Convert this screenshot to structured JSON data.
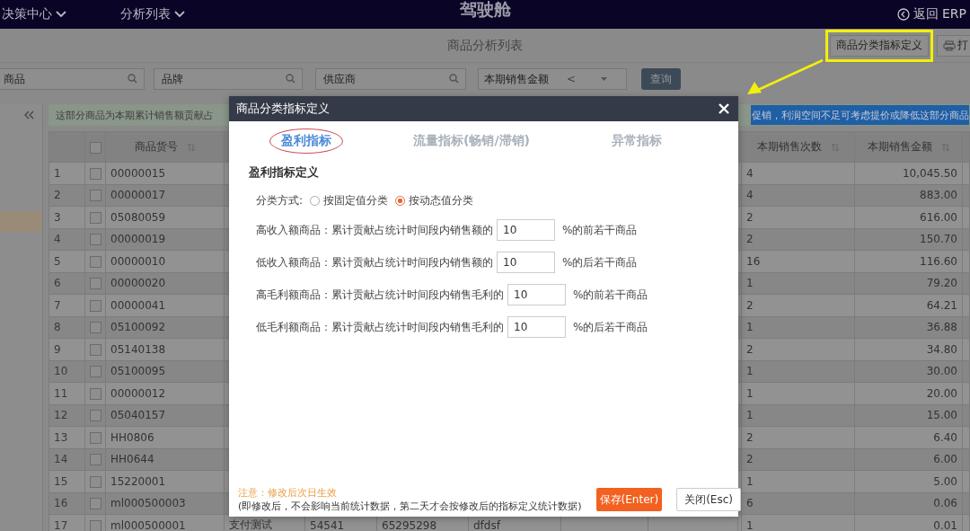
{
  "top_bar": {
    "menus": [
      {
        "label": "决策中心"
      },
      {
        "label": "分析列表"
      }
    ],
    "title": "驾驶舱",
    "back_link": "返回 ERP"
  },
  "page_title": "商品分析列表",
  "toolbar_buttons": [
    {
      "label": "商品分类指标定义",
      "callout": true
    },
    {
      "label": "打",
      "callout": false
    }
  ],
  "filters": [
    {
      "kind": "search",
      "placeholder": "商品"
    },
    {
      "kind": "search",
      "placeholder": "品牌"
    },
    {
      "kind": "search",
      "placeholder": "供应商"
    },
    {
      "kind": "select",
      "label": "本期销售金额",
      "operator": "<"
    }
  ],
  "query_button": "查询",
  "banner": {
    "text_left": "这部分商品为本期累计销售额贡献占",
    "text_right": "促销，利润空间不足可考虑提价或降低这部分商品"
  },
  "table": {
    "select_all_checked": false,
    "columns": [
      "商品货号",
      "本期销售次数",
      "本期销售金额"
    ],
    "rows": [
      {
        "index": "1",
        "checked": false,
        "item_no": "00000015",
        "sales_count": "4",
        "sales_amount": "10,045.50"
      },
      {
        "index": "2",
        "checked": false,
        "item_no": "00000017",
        "sales_count": "4",
        "sales_amount": "883.00"
      },
      {
        "index": "3",
        "checked": false,
        "item_no": "05080059",
        "sales_count": "2",
        "sales_amount": "616.00"
      },
      {
        "index": "4",
        "checked": false,
        "item_no": "00000019",
        "sales_count": "2",
        "sales_amount": "150.70"
      },
      {
        "index": "5",
        "checked": false,
        "item_no": "00000010",
        "sales_count": "16",
        "sales_amount": "116.60"
      },
      {
        "index": "6",
        "checked": false,
        "item_no": "00000020",
        "sales_count": "1",
        "sales_amount": "79.20"
      },
      {
        "index": "7",
        "checked": false,
        "item_no": "00000041",
        "sales_count": "2",
        "sales_amount": "64.21"
      },
      {
        "index": "8",
        "checked": false,
        "item_no": "05100092",
        "sales_count": "1",
        "sales_amount": "36.88"
      },
      {
        "index": "9",
        "checked": false,
        "item_no": "05140138",
        "sales_count": "2",
        "sales_amount": "34.80"
      },
      {
        "index": "10",
        "checked": false,
        "item_no": "05100095",
        "sales_count": "1",
        "sales_amount": "30.00"
      },
      {
        "index": "11",
        "checked": false,
        "item_no": "00000012",
        "sales_count": "1",
        "sales_amount": "20.00"
      },
      {
        "index": "12",
        "checked": false,
        "item_no": "05040157",
        "sales_count": "1",
        "sales_amount": "15.00"
      },
      {
        "index": "13",
        "checked": false,
        "item_no": "HH0806",
        "sales_count": "2",
        "sales_amount": "6.40"
      },
      {
        "index": "14",
        "checked": false,
        "item_no": "HH0644",
        "sales_count": "2",
        "sales_amount": "6.00"
      },
      {
        "index": "15",
        "checked": false,
        "item_no": "15220001",
        "sales_count": "1",
        "sales_amount": "5.00"
      },
      {
        "index": "16",
        "checked": false,
        "item_no": "ml000500003",
        "sales_count": "6",
        "sales_amount": "0.06"
      },
      {
        "index": "17",
        "checked": false,
        "item_no": "ml000500001",
        "middle_cells": [
          "支付测试",
          "54541",
          "65295298",
          "dfdsf"
        ],
        "sales_count": "1",
        "sales_amount": "0.01"
      }
    ]
  },
  "modal": {
    "title": "商品分类指标定义",
    "tabs": [
      {
        "label": "盈利指标",
        "selected": true
      },
      {
        "label": "流量指标(畅销/滞销)",
        "selected": false
      },
      {
        "label": "异常指标",
        "selected": false
      }
    ],
    "section_title": "盈利指标定义",
    "mode_label": "分类方式:",
    "mode_options": [
      {
        "label": "按固定值分类",
        "selected": false
      },
      {
        "label": "按动态值分类",
        "selected": true
      }
    ],
    "rules": [
      {
        "label": "高收入额商品：累计贡献占统计时间段内销售额的",
        "value": "10",
        "suffix": "%的前若干商品"
      },
      {
        "label": "低收入额商品：累计贡献占统计时间段内销售额的",
        "value": "10",
        "suffix": "%的后若干商品"
      },
      {
        "label": "高毛利额商品：累计贡献占统计时间段内销售毛利的",
        "value": "10",
        "suffix": "%的前若干商品"
      },
      {
        "label": "低毛利额商品：累计贡献占统计时间段内销售毛利的",
        "value": "10",
        "suffix": "%的后若干商品"
      }
    ],
    "note": "注意：修改后次日生效",
    "note_detail": "(即修改后，不会影响当前统计数据，第二天才会按修改后的指标定义统计数据)",
    "buttons": [
      {
        "kind": "primary",
        "label": "保存(Enter)"
      },
      {
        "kind": "secondary",
        "label": "关闭(Esc)"
      }
    ]
  }
}
